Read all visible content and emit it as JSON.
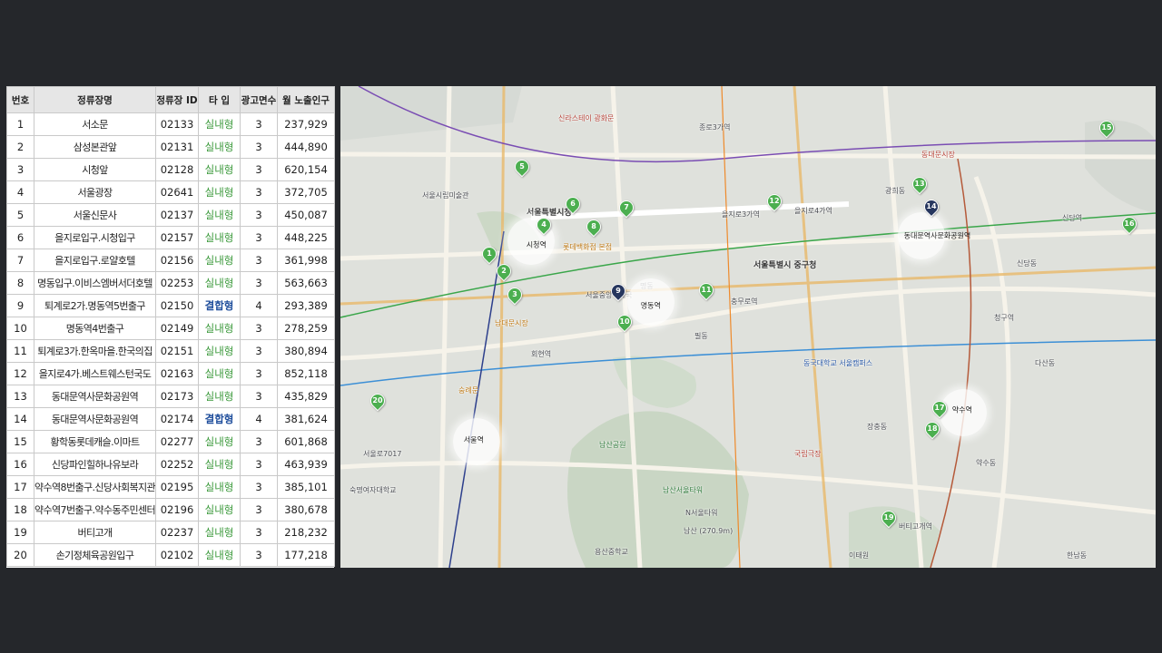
{
  "table": {
    "headers": [
      "번호",
      "정류장명",
      "정류장 ID",
      "타 입",
      "광고면수",
      "월 노출인구"
    ],
    "rows": [
      {
        "no": "1",
        "name": "서소문",
        "id": "02133",
        "type": "실내형",
        "faces": "3",
        "monthly": "237,929"
      },
      {
        "no": "2",
        "name": "삼성본관앞",
        "id": "02131",
        "type": "실내형",
        "faces": "3",
        "monthly": "444,890"
      },
      {
        "no": "3",
        "name": "시청앞",
        "id": "02128",
        "type": "실내형",
        "faces": "3",
        "monthly": "620,154"
      },
      {
        "no": "4",
        "name": "서울광장",
        "id": "02641",
        "type": "실내형",
        "faces": "3",
        "monthly": "372,705"
      },
      {
        "no": "5",
        "name": "서울신문사",
        "id": "02137",
        "type": "실내형",
        "faces": "3",
        "monthly": "450,087"
      },
      {
        "no": "6",
        "name": "을지로입구.시청입구",
        "id": "02157",
        "type": "실내형",
        "faces": "3",
        "monthly": "448,225"
      },
      {
        "no": "7",
        "name": "을지로입구.로얄호텔",
        "id": "02156",
        "type": "실내형",
        "faces": "3",
        "monthly": "361,998"
      },
      {
        "no": "8",
        "name": "명동입구.이비스엠버서더호텔",
        "id": "02253",
        "type": "실내형",
        "faces": "3",
        "monthly": "563,663"
      },
      {
        "no": "9",
        "name": "퇴계로2가.명동역5번출구",
        "id": "02150",
        "type": "결합형",
        "faces": "4",
        "monthly": "293,389"
      },
      {
        "no": "10",
        "name": "명동역4번출구",
        "id": "02149",
        "type": "실내형",
        "faces": "3",
        "monthly": "278,259"
      },
      {
        "no": "11",
        "name": "퇴계로3가.한옥마을.한국의집",
        "id": "02151",
        "type": "실내형",
        "faces": "3",
        "monthly": "380,894"
      },
      {
        "no": "12",
        "name": "을지로4가.베스트웨스턴국도",
        "id": "02163",
        "type": "실내형",
        "faces": "3",
        "monthly": "852,118"
      },
      {
        "no": "13",
        "name": "동대문역사문화공원역",
        "id": "02173",
        "type": "실내형",
        "faces": "3",
        "monthly": "435,829"
      },
      {
        "no": "14",
        "name": "동대문역사문화공원역",
        "id": "02174",
        "type": "결합형",
        "faces": "4",
        "monthly": "381,624"
      },
      {
        "no": "15",
        "name": "황학동롯데캐슬.이마트",
        "id": "02277",
        "type": "실내형",
        "faces": "3",
        "monthly": "601,868"
      },
      {
        "no": "16",
        "name": "신당파인힐하나유보라",
        "id": "02252",
        "type": "실내형",
        "faces": "3",
        "monthly": "463,939"
      },
      {
        "no": "17",
        "name": "약수역8번출구.신당사회복지관",
        "id": "02195",
        "type": "실내형",
        "faces": "3",
        "monthly": "385,101"
      },
      {
        "no": "18",
        "name": "약수역7번출구.약수동주민센터",
        "id": "02196",
        "type": "실내형",
        "faces": "3",
        "monthly": "380,678"
      },
      {
        "no": "19",
        "name": "버티고개",
        "id": "02237",
        "type": "실내형",
        "faces": "3",
        "monthly": "218,232"
      },
      {
        "no": "20",
        "name": "손기정체육공원입구",
        "id": "02102",
        "type": "실내형",
        "faces": "3",
        "monthly": "177,218"
      }
    ]
  },
  "map": {
    "stations": [
      "시청역",
      "명동역",
      "동대문역사문화공원역",
      "서울역",
      "약수역"
    ],
    "labels": [
      "서울특별시청",
      "서울특별시 중구청",
      "남산서울타워",
      "국립극장",
      "동국대학교 서울캠퍼스",
      "남산공원",
      "을지로3가역",
      "을지로4가역",
      "충무로역",
      "회현역",
      "종로3가역",
      "신당역",
      "청구역",
      "버티고개역",
      "숭례문",
      "신라스테이 광화문",
      "롯데백화점 본점",
      "남대문시장",
      "서울중앙우체국",
      "서울시립미술관",
      "동대문시장",
      "광희동",
      "신당동",
      "약수동",
      "다산동",
      "장충동",
      "필동",
      "명동",
      "남산 (270.9m)",
      "이태원",
      "한남동",
      "서울로7017",
      "숙명여자대학교",
      "용산중학교",
      "N서울타워"
    ],
    "pins": [
      "1",
      "2",
      "3",
      "4",
      "5",
      "6",
      "7",
      "8",
      "9",
      "10",
      "11",
      "12",
      "13",
      "14",
      "15",
      "16",
      "17",
      "18",
      "19",
      "20"
    ],
    "colors": {
      "pin_green": "#4caf50",
      "pin_dark": "#26365e",
      "type_indoor": "#3c9a3c",
      "type_combined": "#1f4e9c"
    }
  }
}
